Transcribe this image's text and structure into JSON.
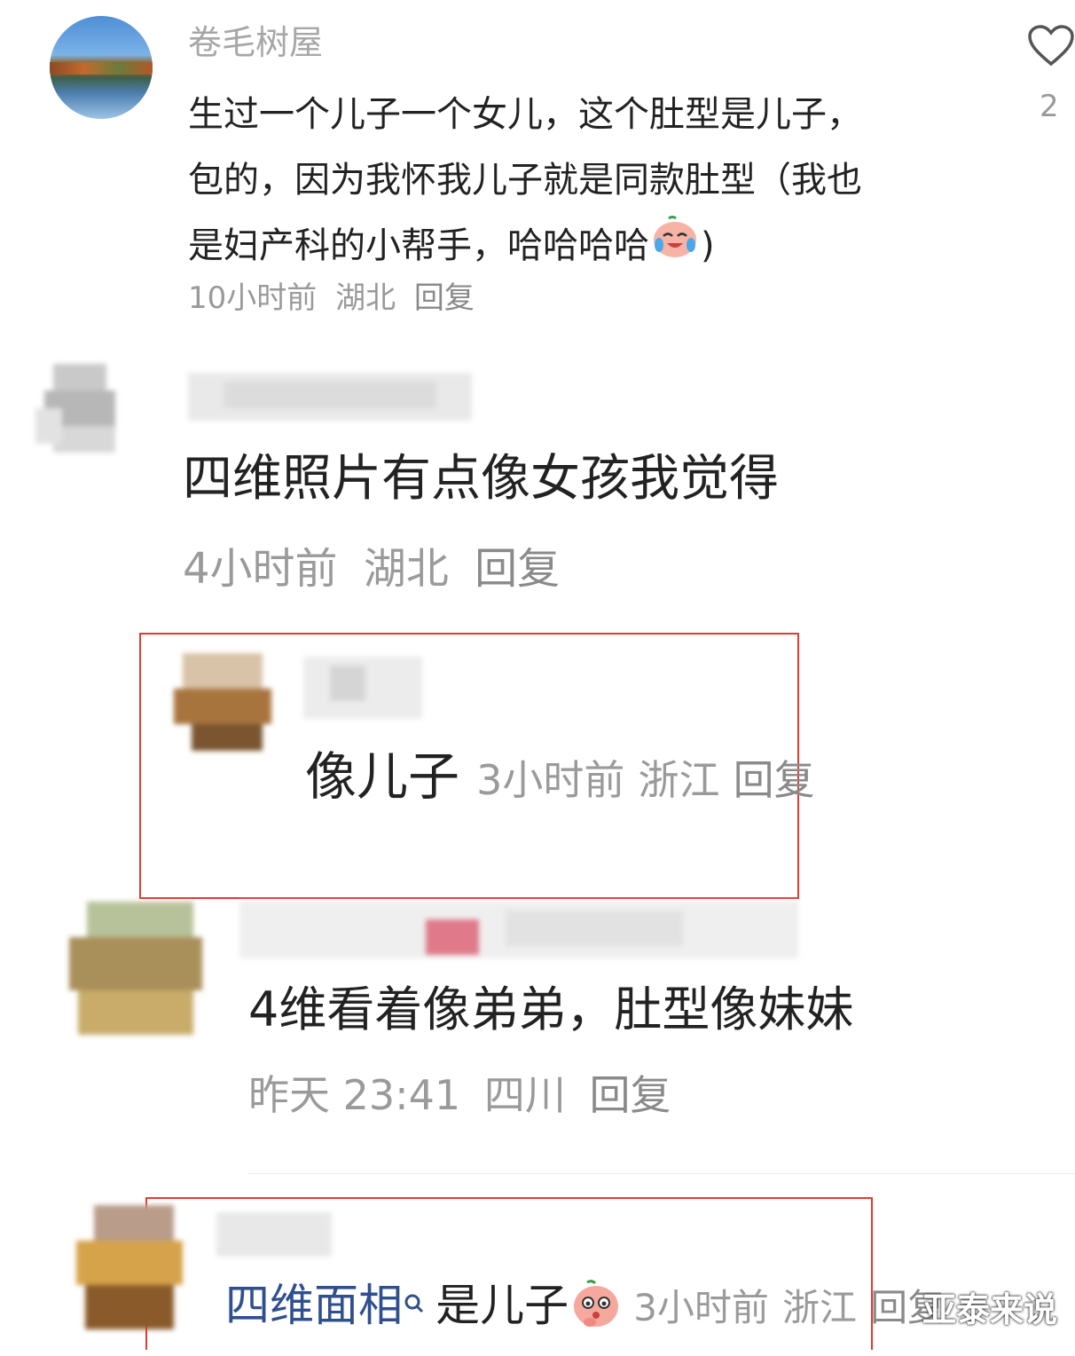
{
  "comments": [
    {
      "username": "卷毛树屋",
      "text_lines": [
        "生过一个儿子一个女儿，这个肚型是儿子，",
        "包的，因为我怀我儿子就是同款肚型（我也",
        "是妇产科的小帮手，哈哈哈哈"
      ],
      "text_tail": ")",
      "time": "10小时前",
      "location": "湖北",
      "reply_label": "回复",
      "likes": "2",
      "avatar_icon": "lake-landscape-avatar",
      "emoji": "crying-laughing-peach-emoji"
    },
    {
      "username": "",
      "text": "四维照片有点像女孩我觉得",
      "time": "4小时前",
      "location": "湖北",
      "reply_label": "回复",
      "avatar_icon": "pixelated-avatar"
    },
    {
      "username": "",
      "text": "像儿子",
      "time": "3小时前",
      "location": "浙江",
      "reply_label": "回复",
      "avatar_icon": "pixelated-avatar"
    },
    {
      "username": "",
      "text": "4维看着像弟弟，肚型像妹妹",
      "time": "昨天 23:41",
      "location": "四川",
      "reply_label": "回复",
      "avatar_icon": "pixelated-avatar"
    },
    {
      "username": "",
      "topic_link": "四维面相",
      "topic_icon": "search-icon",
      "text": "是儿子",
      "time": "3小时前",
      "location": "浙江",
      "reply_label": "回复",
      "avatar_icon": "pixelated-avatar",
      "emoji": "pondering-peach-emoji"
    }
  ],
  "watermark": "亚泰来说",
  "colors": {
    "highlight_box": "#e23b30",
    "topic_link": "#2f4f8f",
    "meta": "#9a9a9a"
  }
}
